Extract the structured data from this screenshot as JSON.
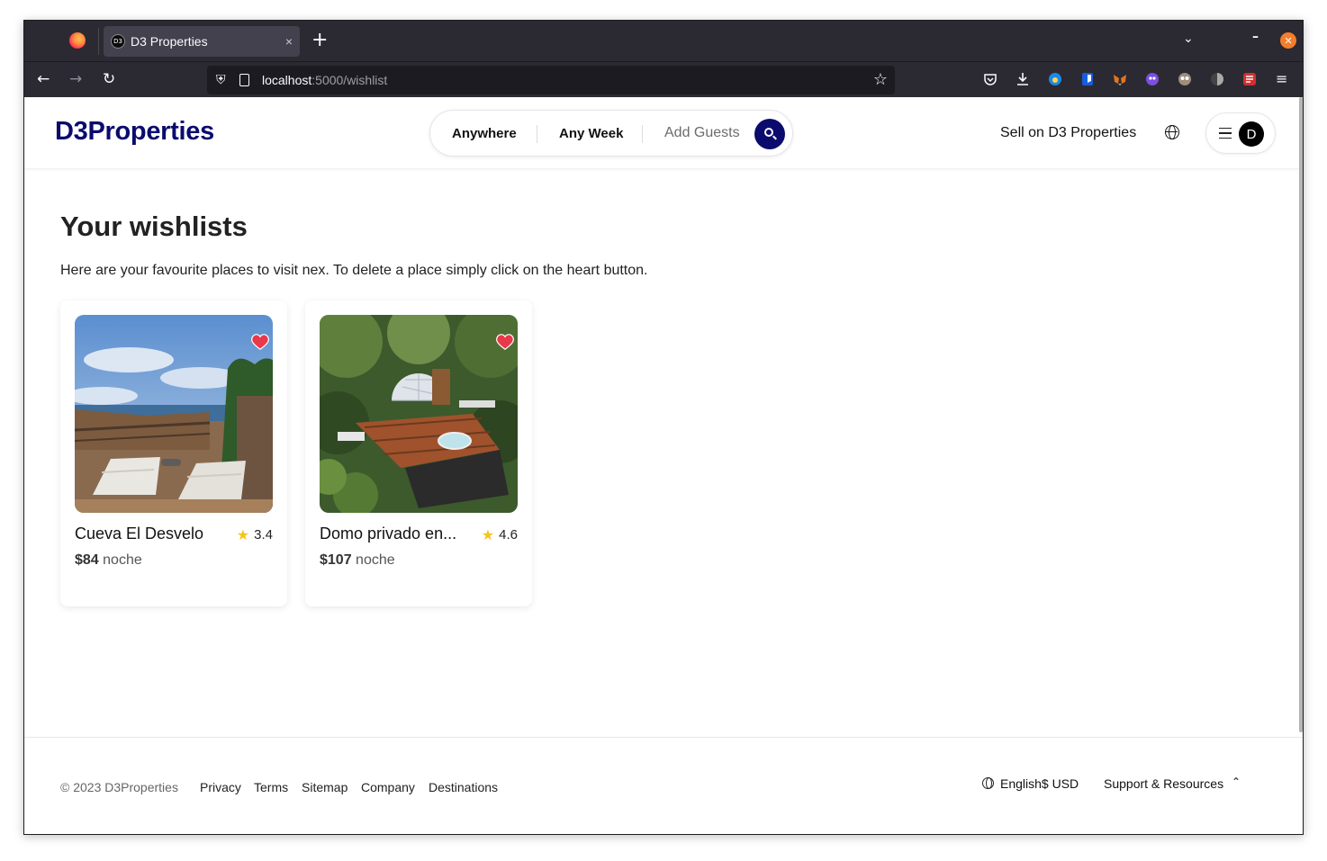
{
  "browser": {
    "tab_title": "D3 Properties",
    "tab_favicon_text": "D3",
    "url_host": "localhost",
    "url_rest": ":5000/wishlist",
    "close_tab_glyph": "×",
    "new_tab_glyph": "+"
  },
  "header": {
    "logo": "D3Properties",
    "search": {
      "anywhere": "Anywhere",
      "any_week": "Any Week",
      "add_guests": "Add Guests"
    },
    "sell_link": "Sell on D3 Properties",
    "avatar_letter": "D"
  },
  "main": {
    "title": "Your wishlists",
    "subtitle": "Here are your favourite places to visit nex. To delete a place simply click on the heart button.",
    "cards": [
      {
        "title": "Cueva El Desvelo",
        "rating": "3.4",
        "price": "$84",
        "price_unit": "noche"
      },
      {
        "title": "Domo privado en...",
        "rating": "4.6",
        "price": "$107",
        "price_unit": "noche"
      }
    ]
  },
  "footer": {
    "copyright": "© 2023 D3Properties",
    "links": [
      "Privacy",
      "Terms",
      "Sitemap",
      "Company",
      "Destinations"
    ],
    "language": "English$ USD",
    "support": "Support & Resources"
  },
  "colors": {
    "brand": "#0b0b6e",
    "heart": "#e8394a",
    "star": "#f5c518"
  }
}
